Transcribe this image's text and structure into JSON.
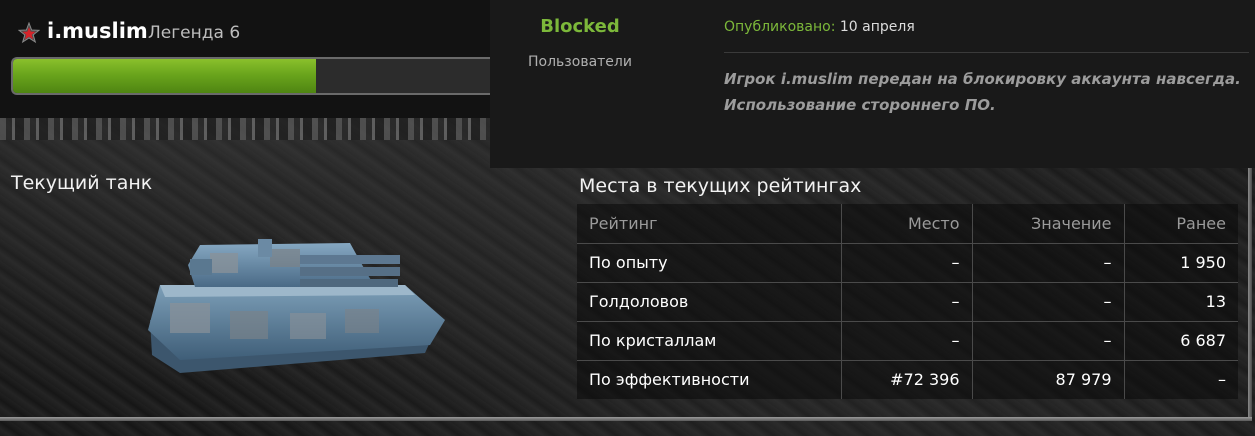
{
  "profile": {
    "username": "i.muslim",
    "rank_name": "Легенда 6",
    "rank_icon": "star-rank-icon",
    "xp_progress": 0.62
  },
  "notification": {
    "status": "Blocked",
    "category": "Пользователи",
    "published_label": "Опубликовано:",
    "published_date": "10 апреля",
    "message": "Игрок i.muslim передан на блокировку аккаунта навсегда. Использование стороннего ПО."
  },
  "tank": {
    "title": "Текущий танк",
    "image_icon": "tank-icon"
  },
  "ratings": {
    "title": "Места в текущих рейтингах",
    "headers": {
      "name": "Рейтинг",
      "place": "Место",
      "value": "Значение",
      "previous": "Ранее"
    },
    "rows": [
      {
        "name": "По опыту",
        "place": "–",
        "value": "–",
        "previous": "1 950"
      },
      {
        "name": "Голдоловов",
        "place": "–",
        "value": "–",
        "previous": "13"
      },
      {
        "name": "По кристаллам",
        "place": "–",
        "value": "–",
        "previous": "6 687"
      },
      {
        "name": "По эффективности",
        "place": "#72 396",
        "value": "87 979",
        "previous": "–"
      }
    ]
  },
  "colors": {
    "accent_green": "#7cb83a",
    "xp_fill": "#6aa51c",
    "rank_star": "#d6242a"
  }
}
